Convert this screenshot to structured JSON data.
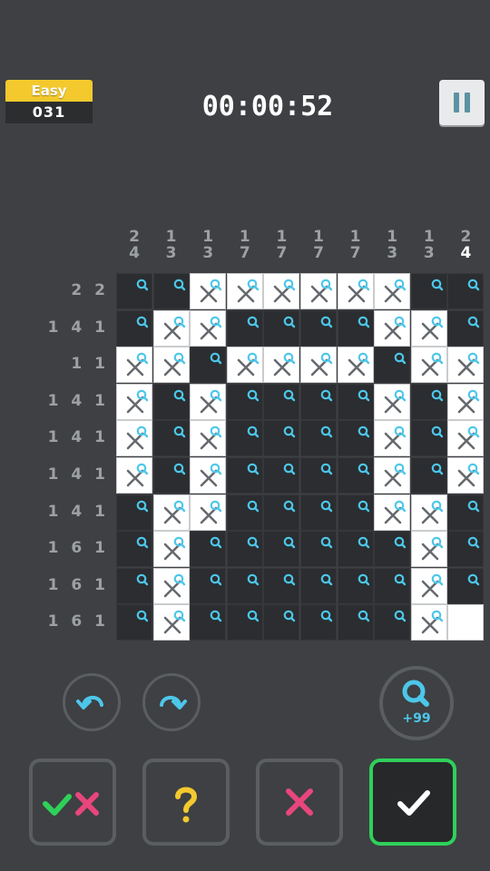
{
  "header": {
    "difficulty": "Easy",
    "level": "031",
    "timer": "00:00:52"
  },
  "puzzle": {
    "col_clues": [
      [
        "2",
        "4"
      ],
      [
        "1",
        "3"
      ],
      [
        "1",
        "3"
      ],
      [
        "1",
        "7"
      ],
      [
        "1",
        "7"
      ],
      [
        "1",
        "7"
      ],
      [
        "1",
        "7"
      ],
      [
        "1",
        "3"
      ],
      [
        "1",
        "3"
      ],
      [
        "2",
        "4"
      ]
    ],
    "row_clues": [
      "2 2",
      "1 4 1",
      "1 1",
      "1 4 1",
      "1 4 1",
      "1 4 1",
      "1 4 1",
      "1 6 1",
      "1 6 1",
      "1 6 1"
    ],
    "grid": [
      "DDXXXXXXDD",
      "DXXDDDDXXD",
      "XXDXXXXDXX",
      "XDXDDDDXDX",
      "XDXDDDDXDX",
      "XDXDDDDXDX",
      "DXXDDDDXXD",
      "DXDDDDDDXD",
      "DXDDDDDDXD",
      "DXDDDDDDXW"
    ]
  },
  "controls": {
    "hint_count": "+99"
  },
  "colors": {
    "accent": "#4cc7ea",
    "check": "#2fd05a",
    "cross": "#e8467c",
    "question": "#f4c92e"
  }
}
